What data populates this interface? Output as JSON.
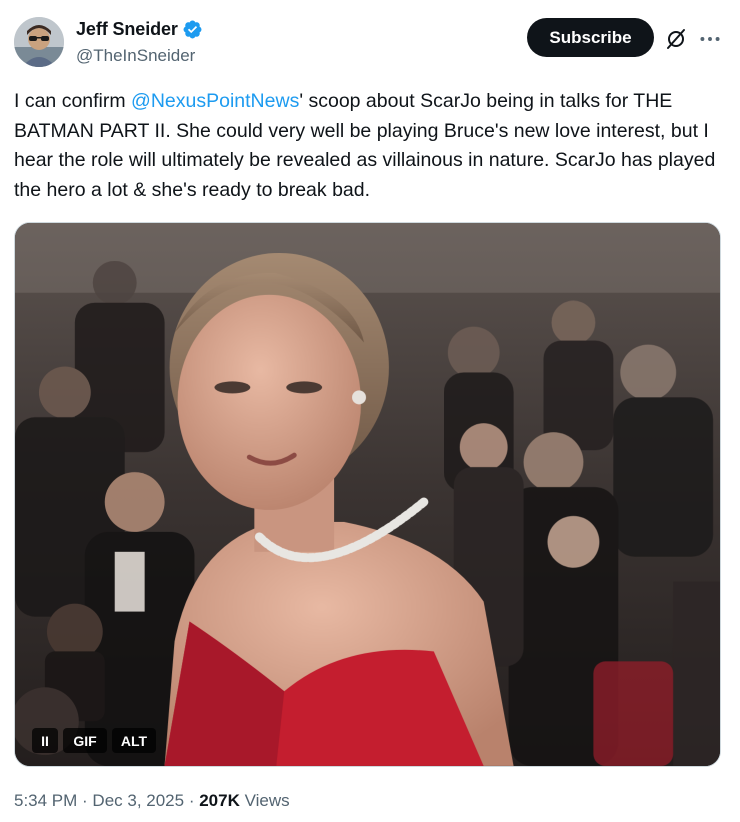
{
  "author": {
    "display_name": "Jeff Sneider",
    "handle": "@TheInSneider",
    "verified_icon": "verified-badge-icon",
    "avatar_icon": "avatar"
  },
  "actions": {
    "subscribe_label": "Subscribe",
    "grok_icon": "grok-icon",
    "more_icon": "more-icon"
  },
  "tweet": {
    "text_before": "I can confirm ",
    "mention": "@NexusPointNews",
    "text_after": "' scoop about ScarJo being in talks for THE BATMAN PART II. She could very well be playing Bruce's new love interest, but I hear the role will ultimately be revealed as villainous in nature. ScarJo has played the hero a lot & she's ready to break bad."
  },
  "media": {
    "type": "GIF",
    "badges": {
      "pause": "II",
      "gif": "GIF",
      "alt": "ALT"
    }
  },
  "meta": {
    "time": "5:34 PM",
    "separator": " · ",
    "date": "Dec 3, 2025",
    "views_count": "207K",
    "views_label": " Views"
  },
  "colors": {
    "accent": "#1d9bf0",
    "text": "#0f1419",
    "secondary": "#536471",
    "dress": "#c41e2f"
  }
}
